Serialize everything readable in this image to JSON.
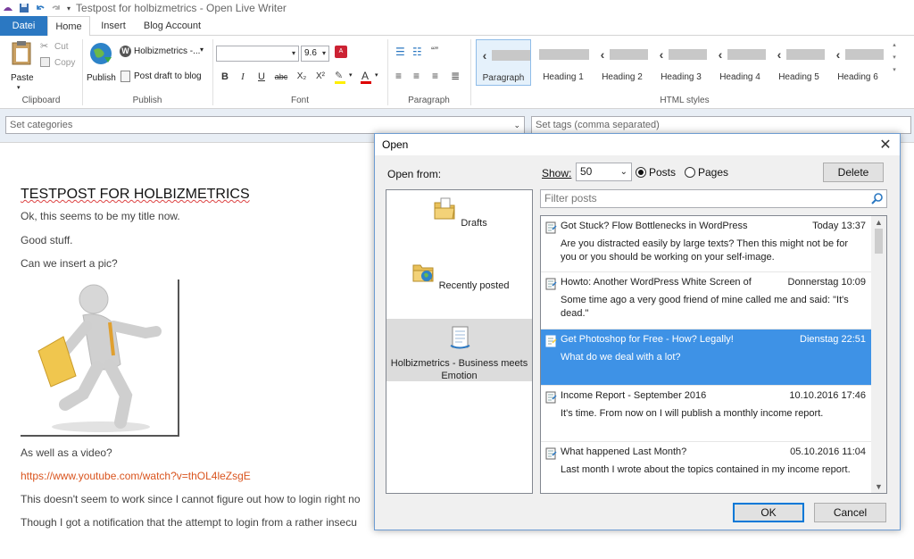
{
  "window": {
    "title": "Testpost for holbizmetrics - Open Live Writer"
  },
  "tabs": [
    {
      "label": "Datei"
    },
    {
      "label": "Home"
    },
    {
      "label": "Insert"
    },
    {
      "label": "Blog Account"
    }
  ],
  "ribbon": {
    "clipboard": {
      "paste": "Paste",
      "cut": "Cut",
      "copy": "Copy",
      "group": "Clipboard"
    },
    "publish": {
      "publish": "Publish",
      "blog_name": "Holbizmetrics -...",
      "draft": "Post draft to blog",
      "group": "Publish"
    },
    "font": {
      "size": "9.6",
      "group": "Font",
      "bold": "B",
      "italic": "I",
      "underline": "U",
      "strike": "abc",
      "sub": "X₂",
      "sup": "X²",
      "color_letter": "A"
    },
    "paragraph": {
      "group": "Paragraph",
      "quote": "“”"
    },
    "styles": {
      "group": "HTML styles",
      "items": [
        {
          "label": "Paragraph"
        },
        {
          "label": "Heading 1"
        },
        {
          "label": "Heading 2"
        },
        {
          "label": "Heading 3"
        },
        {
          "label": "Heading 4"
        },
        {
          "label": "Heading 5"
        },
        {
          "label": "Heading 6"
        }
      ]
    }
  },
  "categories": {
    "placeholder": "Set categories"
  },
  "tags": {
    "placeholder": "Set tags (comma separated)"
  },
  "editor": {
    "title": "TESTPOST FOR HOLBIZMETRICS",
    "lines": [
      "Ok, this seems to be my title now.",
      "Good stuff.",
      "Can we insert a pic?",
      "As well as a video?",
      "https://www.youtube.com/watch?v=thOL4leZsgE",
      "This doesn't seem to work since I cannot figure out how to login right no",
      "Though I got a notification that the attempt to login from a rather insecu"
    ]
  },
  "dialog": {
    "title": "Open",
    "open_from_label": "Open from:",
    "show_label": "Show:",
    "show_value": "50",
    "radio_posts": "Posts",
    "radio_pages": "Pages",
    "delete": "Delete",
    "filter_placeholder": "Filter posts",
    "ok": "OK",
    "cancel": "Cancel",
    "sources": [
      {
        "label": "Drafts"
      },
      {
        "label": "Recently posted"
      },
      {
        "label": "Holbizmetrics - Business meets Emotion"
      }
    ],
    "posts": [
      {
        "title": "Got Stuck? Flow Bottlenecks in WordPress",
        "date": "Today 13:37",
        "excerpt": "Are you distracted easily by large texts? Then this might not be for you or you should be working on your self-image."
      },
      {
        "title": "Howto: Another WordPress White Screen of",
        "date": "Donnerstag 10:09",
        "excerpt": "Some time ago a very good friend of mine called me and said: \"It's dead.\""
      },
      {
        "title": "Get Photoshop for Free - How? Legally!",
        "date": "Dienstag 22:51",
        "excerpt": "What do we deal with a lot?"
      },
      {
        "title": "Income Report - September 2016",
        "date": "10.10.2016 17:46",
        "excerpt": "It's time. From now on I will publish a monthly income report."
      },
      {
        "title": "What happened Last Month?",
        "date": "05.10.2016 11:04",
        "excerpt": "Last month I wrote about the topics contained in my income report."
      }
    ]
  },
  "colors": {
    "accent": "#2b78c2",
    "selection": "#3e92e6",
    "link": "#d9541e"
  }
}
